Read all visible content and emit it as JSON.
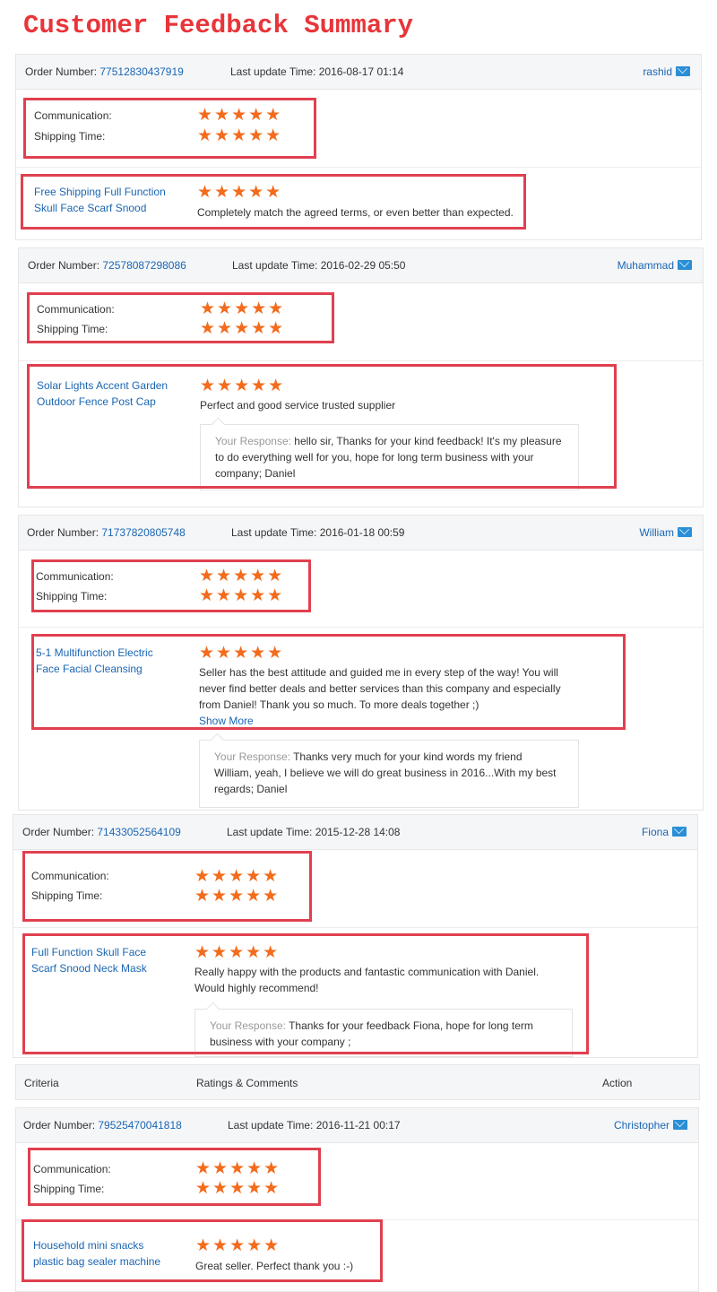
{
  "page_title": "Customer Feedback Summary",
  "labels": {
    "order_number": "Order Number:",
    "last_update": "Last update Time:",
    "communication": "Communication:",
    "shipping_time": "Shipping Time:",
    "your_response": "Your Response:"
  },
  "table_header": {
    "criteria": "Criteria",
    "ratings": "Ratings & Comments",
    "action": "Action"
  },
  "colors": {
    "accent": "#e8353a",
    "star": "#f36b1c",
    "link": "#1a66b3",
    "highlight_border": "#e04050"
  },
  "feedback": [
    {
      "order_number": "77512830437919",
      "last_update": "2016-08-17 01:14",
      "user": "rashid",
      "communication_stars": 5,
      "shipping_stars": 5,
      "product_line1": "Free Shipping Full Function",
      "product_line2": "Skull Face Scarf Snood",
      "product_stars": 5,
      "comment": "Completely match the agreed terms, or even better than expected."
    },
    {
      "order_number": "72578087298086",
      "last_update": "2016-02-29 05:50",
      "user": "Muhammad",
      "communication_stars": 5,
      "shipping_stars": 5,
      "product_line1": "Solar Lights Accent Garden",
      "product_line2": "Outdoor Fence Post Cap",
      "product_stars": 5,
      "comment": "Perfect and good service trusted supplier",
      "response_line1": "hello sir, Thanks for your kind feedback! It's my pleasure",
      "response_line2": "to do everything well for you, hope for long term business with your",
      "response_line3": "company; Daniel"
    },
    {
      "order_number": "71737820805748",
      "last_update": "2016-01-18 00:59",
      "user": "William",
      "communication_stars": 5,
      "shipping_stars": 5,
      "product_line1": "5-1 Multifunction Electric",
      "product_line2": "Face Facial Cleansing",
      "product_stars": 5,
      "comment_line1": "Seller has the best attitude and guided me in every step of the way! You will",
      "comment_line2": "never find better deals and better services than this company and especially",
      "comment_line3": "from Daniel! Thank you so much. To more deals together ;)",
      "show_more": "Show More",
      "response_line1": "Thanks very much for your kind words my friend",
      "response_line2": "William, yeah, I believe we will do great business in 2016...With my best",
      "response_line3": "regards; Daniel"
    },
    {
      "order_number": "71433052564109",
      "last_update": "2015-12-28 14:08",
      "user": "Fiona",
      "communication_stars": 5,
      "shipping_stars": 5,
      "product_line1": "Full Function Skull Face",
      "product_line2": "Scarf Snood Neck Mask",
      "product_stars": 5,
      "comment_line1": "Really happy with the products and fantastic communication with Daniel.",
      "comment_line2": "Would highly recommend!",
      "response_line1": "Thanks for your feedback Fiona, hope for long term",
      "response_line2": "business with your company ;"
    },
    {
      "order_number": "79525470041818",
      "last_update": "2016-11-21 00:17",
      "user": "Christopher",
      "communication_stars": 5,
      "shipping_stars": 5,
      "product_line1": "Household mini snacks",
      "product_line2": "plastic bag sealer machine",
      "product_stars": 5,
      "comment": "Great seller. Perfect thank you :-)"
    }
  ]
}
